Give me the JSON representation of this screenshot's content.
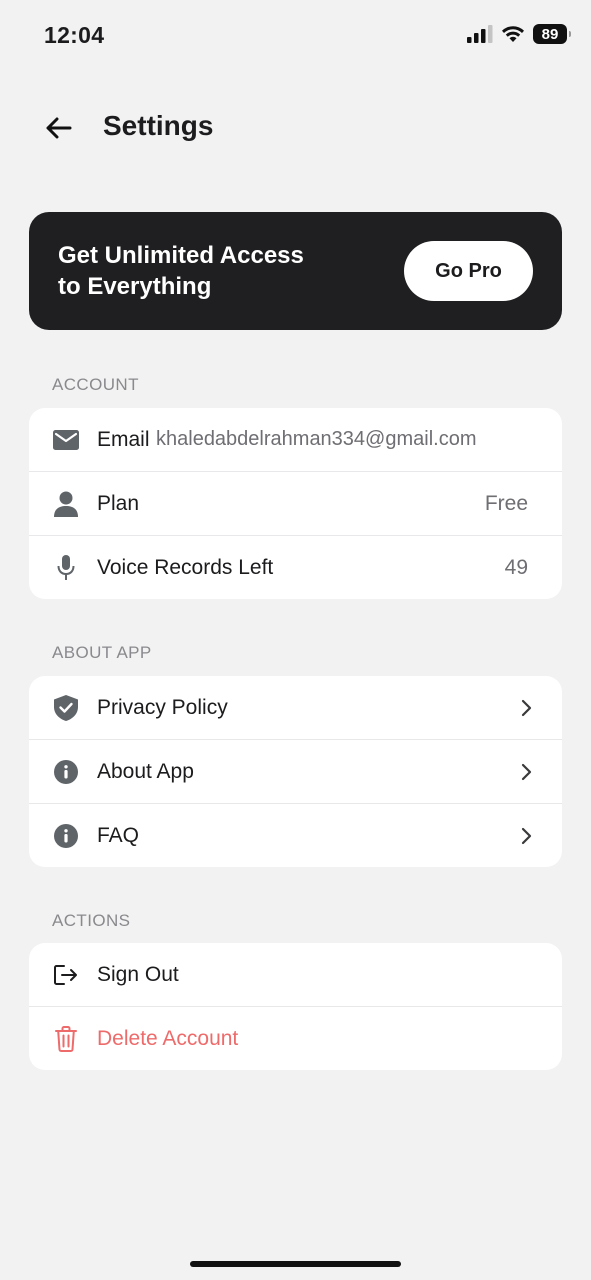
{
  "status": {
    "time": "12:04",
    "battery": "89"
  },
  "nav": {
    "title": "Settings",
    "back_icon": "arrow-left-icon"
  },
  "promo": {
    "line1": "Get Unlimited Access",
    "line2": "to Everything",
    "button": "Go Pro"
  },
  "account": {
    "heading": "ACCOUNT",
    "email_label": "Email",
    "email_value": "khaledabdelrahman334@gmail.com",
    "plan_label": "Plan",
    "plan_value": "Free",
    "voice_label": "Voice Records Left",
    "voice_value": "49"
  },
  "about": {
    "heading": "ABOUT APP",
    "items": [
      {
        "label": "Privacy Policy",
        "icon": "shield-check-icon"
      },
      {
        "label": "About App",
        "icon": "info-icon"
      },
      {
        "label": "FAQ",
        "icon": "info-icon"
      }
    ]
  },
  "actions": {
    "heading": "ACTIONS",
    "sign_out": "Sign Out",
    "delete_account": "Delete Account"
  },
  "colors": {
    "background": "#f2f2f2",
    "promo_bg": "#1f1f21",
    "icon_gray": "#5f6469",
    "danger": "#ee6b6b"
  }
}
